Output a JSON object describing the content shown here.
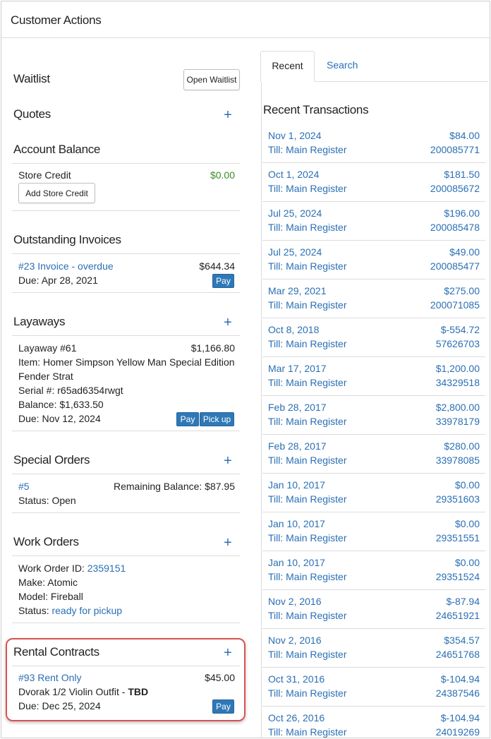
{
  "header": {
    "title": "Customer Actions"
  },
  "waitlist": {
    "title": "Waitlist",
    "button": "Open Waitlist"
  },
  "quotes": {
    "title": "Quotes",
    "add": "+"
  },
  "account_balance": {
    "title": "Account Balance",
    "store_credit_label": "Store Credit",
    "store_credit_value": "$0.00",
    "add_button": "Add Store Credit"
  },
  "outstanding_invoices": {
    "title": "Outstanding Invoices",
    "items": [
      {
        "link": "#23 Invoice - overdue",
        "amount": "$644.34",
        "due": "Due: Apr 28, 2021",
        "pay": "Pay"
      }
    ]
  },
  "layaways": {
    "title": "Layaways",
    "add": "+",
    "items": [
      {
        "name": "Layaway #61",
        "amount": "$1,166.80",
        "item_line1": "Item: Homer Simpson Yellow Man Special Edition",
        "item_line2": "Fender Strat",
        "serial": "Serial #: r65ad6354rwgt",
        "balance": "Balance: $1,633.50",
        "due": "Due: Nov 12, 2024",
        "pay": "Pay",
        "pickup": "Pick up"
      }
    ]
  },
  "special_orders": {
    "title": "Special Orders",
    "add": "+",
    "items": [
      {
        "link": "#5",
        "remaining": "Remaining Balance: $87.95",
        "status": "Status: Open"
      }
    ]
  },
  "work_orders": {
    "title": "Work Orders",
    "add": "+",
    "items": [
      {
        "id_label": "Work Order ID:",
        "id_value": "2359151",
        "make": "Make: Atomic",
        "model": "Model: Fireball",
        "status_label": "Status:",
        "status_value": "ready for pickup"
      }
    ]
  },
  "rental_contracts": {
    "title": "Rental Contracts",
    "add": "+",
    "highlight_color": "#d9534f",
    "items": [
      {
        "link": "#93 Rent Only",
        "amount": "$45.00",
        "desc": "Dvorak 1/2 Violin Outfit - ",
        "desc_bold": "TBD",
        "due": "Due: Dec 25, 2024",
        "pay": "Pay"
      }
    ]
  },
  "tabs": {
    "recent": "Recent",
    "search": "Search"
  },
  "recent_transactions": {
    "title": "Recent Transactions",
    "items": [
      {
        "date": "Nov 1, 2024",
        "amount": "$84.00",
        "till": "Till: Main Register",
        "number": "200085771"
      },
      {
        "date": "Oct 1, 2024",
        "amount": "$181.50",
        "till": "Till: Main Register",
        "number": "200085672"
      },
      {
        "date": "Jul 25, 2024",
        "amount": "$196.00",
        "till": "Till: Main Register",
        "number": "200085478"
      },
      {
        "date": "Jul 25, 2024",
        "amount": "$49.00",
        "till": "Till: Main Register",
        "number": "200085477"
      },
      {
        "date": "Mar 29, 2021",
        "amount": "$275.00",
        "till": "Till: Main Register",
        "number": "200071085"
      },
      {
        "date": "Oct 8, 2018",
        "amount": "$-554.72",
        "till": "Till: Main Register",
        "number": "57626703"
      },
      {
        "date": "Mar 17, 2017",
        "amount": "$1,200.00",
        "till": "Till: Main Register",
        "number": "34329518"
      },
      {
        "date": "Feb 28, 2017",
        "amount": "$2,800.00",
        "till": "Till: Main Register",
        "number": "33978179"
      },
      {
        "date": "Feb 28, 2017",
        "amount": "$280.00",
        "till": "Till: Main Register",
        "number": "33978085"
      },
      {
        "date": "Jan 10, 2017",
        "amount": "$0.00",
        "till": "Till: Main Register",
        "number": "29351603"
      },
      {
        "date": "Jan 10, 2017",
        "amount": "$0.00",
        "till": "Till: Main Register",
        "number": "29351551"
      },
      {
        "date": "Jan 10, 2017",
        "amount": "$0.00",
        "till": "Till: Main Register",
        "number": "29351524"
      },
      {
        "date": "Nov 2, 2016",
        "amount": "$-87.94",
        "till": "Till: Main Register",
        "number": "24651921"
      },
      {
        "date": "Nov 2, 2016",
        "amount": "$354.57",
        "till": "Till: Main Register",
        "number": "24651768"
      },
      {
        "date": "Oct 31, 2016",
        "amount": "$-104.94",
        "till": "Till: Main Register",
        "number": "24387546"
      },
      {
        "date": "Oct 26, 2016",
        "amount": "$-104.94",
        "till": "Till: Main Register",
        "number": "24019269"
      }
    ]
  }
}
